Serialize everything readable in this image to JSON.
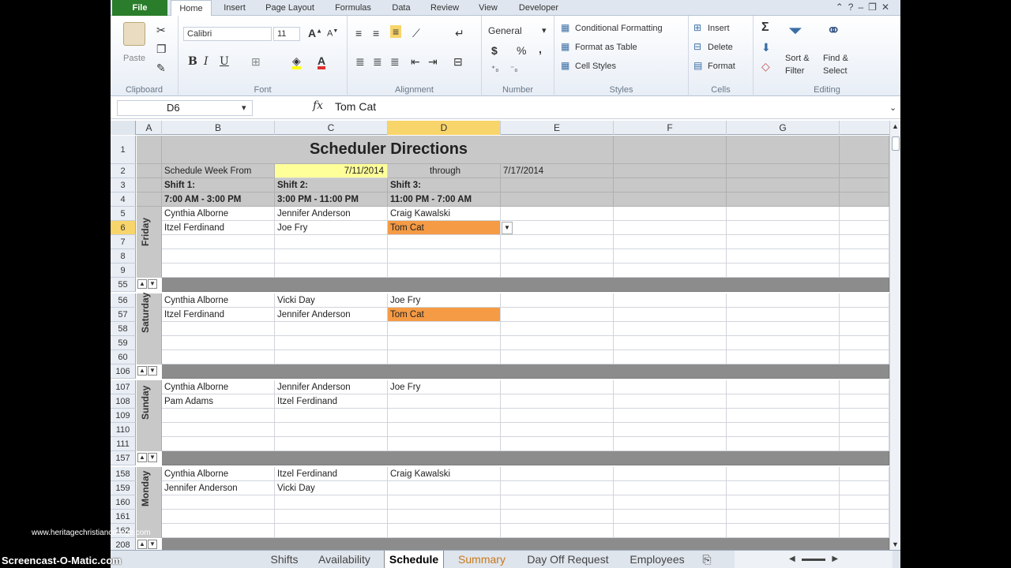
{
  "ribbon": {
    "tabs": [
      "File",
      "Home",
      "Insert",
      "Page Layout",
      "Formulas",
      "Data",
      "Review",
      "View",
      "Developer"
    ],
    "active_tab": "Home",
    "clipboard": {
      "paste": "Paste",
      "label": "Clipboard"
    },
    "font": {
      "name": "Calibri",
      "size": "11",
      "label": "Font",
      "bold": "B",
      "italic": "I",
      "underline": "U"
    },
    "alignment": {
      "label": "Alignment"
    },
    "number": {
      "format": "General",
      "currency": "$",
      "percent": "%",
      "comma": ",",
      "label": "Number"
    },
    "styles": {
      "conditional": "Conditional Formatting",
      "table": "Format as Table",
      "cell": "Cell Styles",
      "label": "Styles"
    },
    "cells": {
      "insert": "Insert",
      "delete": "Delete",
      "format": "Format",
      "label": "Cells"
    },
    "editing": {
      "sum": "Σ",
      "sort": "Sort &",
      "filter": "Filter",
      "find": "Find &",
      "select": "Select",
      "label": "Editing"
    }
  },
  "formula_bar": {
    "name_box": "D6",
    "fx": "fx",
    "value": "Tom Cat"
  },
  "columns": [
    "A",
    "B",
    "C",
    "D",
    "E",
    "F",
    "G"
  ],
  "sheet": {
    "title": "Scheduler Directions",
    "row2": {
      "label": "Schedule Week From",
      "from": "7/11/2014",
      "through": "through",
      "to": "7/17/2014"
    },
    "shifts": [
      "Shift 1:",
      "Shift 2:",
      "Shift 3:"
    ],
    "times": [
      "7:00 AM - 3:00 PM",
      "3:00 PM - 11:00 PM",
      "11:00 PM - 7:00 AM"
    ],
    "days": [
      {
        "name": "Friday",
        "rows": [
          "5",
          "6",
          "7",
          "8",
          "9"
        ],
        "sep": "55",
        "data": [
          [
            "Cynthia Alborne",
            "Jennifer Anderson",
            "Craig Kawalski"
          ],
          [
            "Itzel Ferdinand",
            "Joe Fry",
            "Tom Cat"
          ]
        ]
      },
      {
        "name": "Saturday",
        "rows": [
          "56",
          "57",
          "58",
          "59",
          "60"
        ],
        "sep": "106",
        "data": [
          [
            "Cynthia Alborne",
            "Vicki Day",
            "Joe Fry"
          ],
          [
            "Itzel Ferdinand",
            "Jennifer Anderson",
            "Tom Cat"
          ]
        ]
      },
      {
        "name": "Sunday",
        "rows": [
          "107",
          "108",
          "109",
          "110",
          "111"
        ],
        "sep": "157",
        "data": [
          [
            "Cynthia Alborne",
            "Jennifer Anderson",
            "Joe Fry"
          ],
          [
            "Pam Adams",
            "Itzel Ferdinand",
            ""
          ]
        ]
      },
      {
        "name": "Monday",
        "rows": [
          "158",
          "159",
          "160",
          "161",
          "162"
        ],
        "sep": "208",
        "data": [
          [
            "Cynthia Alborne",
            "Itzel Ferdinand",
            "Craig Kawalski"
          ],
          [
            "Jennifer Anderson",
            "Vicki Day",
            ""
          ]
        ]
      }
    ]
  },
  "sheet_tabs": [
    "Shifts",
    "Availability",
    "Schedule",
    "Summary",
    "Day Off Request",
    "Employees"
  ],
  "active_sheet": "Schedule",
  "overlay": {
    "watermark": "Screencast-O-Matic.com",
    "site": "www.heritagechristiancollege.com"
  },
  "colors": {
    "highlight": "#f59b45",
    "gray": "#c8c8c8",
    "dark": "#8c8c8c",
    "date": "#ffff99"
  }
}
